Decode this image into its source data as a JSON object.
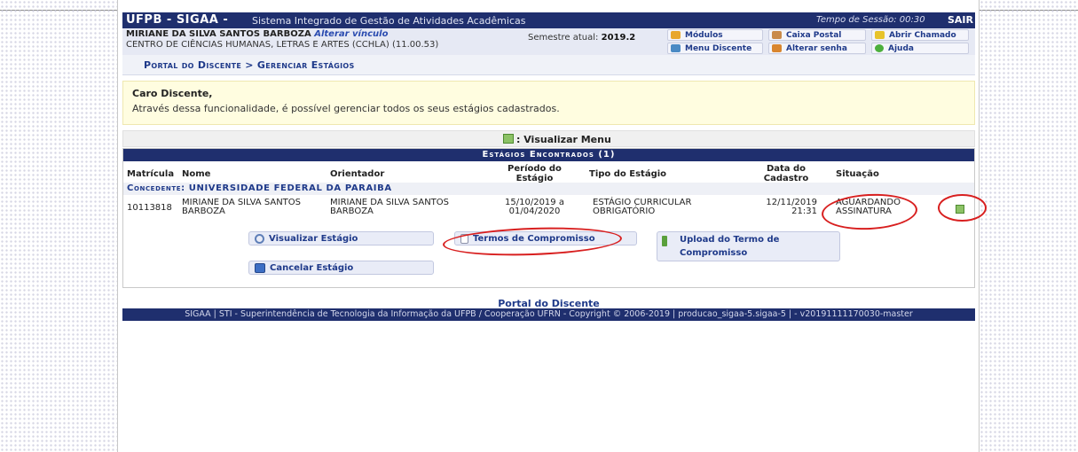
{
  "header": {
    "brand": "UFPB - SIGAA -",
    "system_name": "Sistema Integrado de Gestão de Atividades Acadêmicas",
    "session": "Tempo de Sessão: 00:30",
    "logout": "SAIR"
  },
  "user": {
    "name": "MIRIANE DA SILVA SANTOS BARBOZA",
    "change_link": "Alterar vínculo",
    "center": "CENTRO DE CIÊNCIAS HUMANAS, LETRAS E ARTES (CCHLA) (11.00.53)",
    "semester_label": "Semestre atual:",
    "semester": "2019.2"
  },
  "quick_menu": {
    "modulos": "Módulos",
    "caixa_postal": "Caixa Postal",
    "abrir_chamado": "Abrir Chamado",
    "menu_discente": "Menu Discente",
    "alterar_senha": "Alterar senha",
    "ajuda": "Ajuda"
  },
  "breadcrumb": "Portal do Discente > Gerenciar Estágios",
  "notice": {
    "title": "Caro Discente,",
    "text": "Através dessa funcionalidade, é possível gerenciar todos os seus estágios cadastrados."
  },
  "menu_legend": ": Visualizar Menu",
  "table": {
    "caption": "Estágios Encontrados (1)",
    "headers": {
      "matricula": "Matrícula",
      "nome": "Nome",
      "orientador": "Orientador",
      "periodo_1": "Período do",
      "periodo_2": "Estágio",
      "tipo": "Tipo do Estágio",
      "data_1": "Data do",
      "data_2": "Cadastro",
      "situacao": "Situação"
    },
    "group": "Concedente: UNIVERSIDADE FEDERAL DA PARAIBA",
    "row": {
      "matricula": "10113818",
      "nome_1": "MIRIANE DA SILVA SANTOS",
      "nome_2": "BARBOZA",
      "orientador_1": "MIRIANE DA SILVA SANTOS",
      "orientador_2": "BARBOZA",
      "periodo_1": "15/10/2019 a",
      "periodo_2": "01/04/2020",
      "tipo_1": "ESTÁGIO CURRICULAR",
      "tipo_2": "OBRIGATÓRIO",
      "data_1": "12/11/2019",
      "data_2": "21:31",
      "situacao_1": "AGUARDANDO",
      "situacao_2": "ASSINATURA"
    }
  },
  "actions": {
    "visualizar": "Visualizar Estágio",
    "termos": "Termos de Compromisso",
    "upload_1": "Upload do Termo de",
    "upload_2": "Compromisso",
    "cancelar": "Cancelar Estágio"
  },
  "footer": {
    "link": "Portal do Discente",
    "text": "SIGAA | STI - Superintendência de Tecnologia da Informação da UFPB / Cooperação UFRN - Copyright © 2006-2019 | producao_sigaa-5.sigaa-5 | - v20191111170030-master"
  },
  "colors": {
    "header_bg": "#1f2f6e",
    "link": "#1f3a8a",
    "notice_bg": "#fffde0",
    "annotation": "#d81f1f"
  }
}
